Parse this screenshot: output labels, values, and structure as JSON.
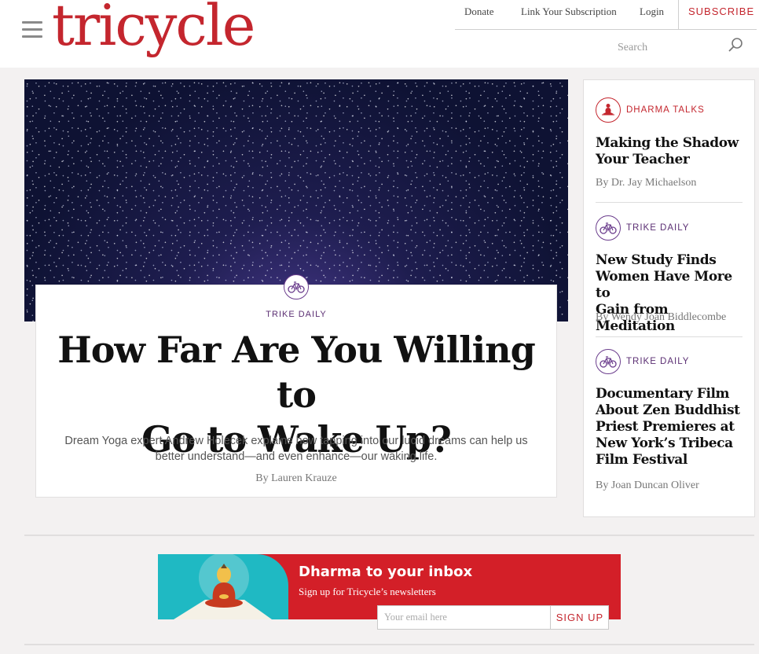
{
  "header": {
    "logo": "tricycle",
    "nav": {
      "donate": "Donate",
      "link_subscription": "Link Your Subscription",
      "login": "Login",
      "subscribe": "SUBSCRIBE"
    },
    "search_placeholder": "Search",
    "brand_color": "#c4262e"
  },
  "hero": {
    "category": "TRIKE DAILY",
    "category_icon": "bicycle-icon",
    "title_line1": "How Far Are You Willing to",
    "title_line2": "Go to Wake Up?",
    "description_line1": "Dream Yoga expert Andrew Holecek explains how tapping into our lucid dreams can help us",
    "description_line2": "better understand—and even enhance—our waking life.",
    "byline": "By Lauren Krauze"
  },
  "sidebar": {
    "items": [
      {
        "category": "DHARMA TALKS",
        "icon": "meditation-icon",
        "title_line1": "Making the Shadow",
        "title_line2": "Your Teacher",
        "byline": "By Dr. Jay Michaelson"
      },
      {
        "category": "TRIKE DAILY",
        "icon": "bicycle-icon",
        "title_line1": "New Study Finds",
        "title_line2": "Women Have More to",
        "title_line3": "Gain from Meditation",
        "byline": "By Wendy Joan Biddlecombe"
      },
      {
        "category": "TRIKE DAILY",
        "icon": "bicycle-icon",
        "title_line1": "Documentary Film",
        "title_line2": "About Zen Buddhist",
        "title_line3": "Priest Premieres at",
        "title_line4": "New York’s Tribeca",
        "title_line5": "Film Festival",
        "byline": "By Joan Duncan Oliver"
      }
    ]
  },
  "newsletter": {
    "title": "Dharma to your inbox",
    "subtitle": "Sign up for Tricycle’s newsletters",
    "email_placeholder": "Your email here",
    "button": "SIGN UP"
  }
}
